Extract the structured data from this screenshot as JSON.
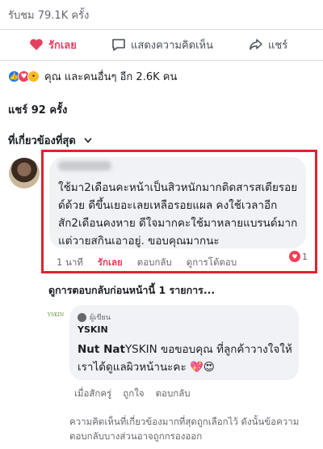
{
  "post": {
    "views": "รับชม 79.1K ครั้ง",
    "actions": {
      "like_label": "รักเลย",
      "comment_label": "แสดงความคิดเห็น",
      "share_label": "แชร์"
    },
    "reactions_text": "คุณ และคนอื่นๆ อีก 2.6K คน",
    "shares_text": "แชร์ 92 ครั้ง",
    "sort_label": "ที่เกี่ยวข้องที่สุด"
  },
  "comment": {
    "text": "ใช้มา2เดือนคะหน้าเป็นสิวหนักมากติดสารสเตียรอยด์ด้วย ดีขึ้นเยอะเลยเหลือรอยแผล คงใช้เวลาอีกสัก2เดือนคงหาย    ดีใจมากคะใช้มาหลายแบรนด์มากแต่วายสกินเอาอยู่. ขอบคุณมากนะ",
    "time": "1 นาที",
    "liked_label": "รักเลย",
    "reply_label": "ตอบกลับ",
    "view_replies_label": "ดูการโต้ตอบ",
    "reaction_count": "1",
    "highlight_color": "#e1222f"
  },
  "previous_replies": "ดูการตอบกลับก่อนหน้านี้ 1 รายการ...",
  "reply": {
    "logo_text": "YSKIN",
    "author_badge": "ผู้เขียน",
    "page_name": "YSKIN",
    "mention": "Nut Nat",
    "text": "YSKIN ขอขอบคุณ ที่ลูกค้าวางใจให้เราได้ดูแลผิวหน้านะคะ 💖😍",
    "time": "เมื่อสักครู่",
    "like_label": "ถูกใจ",
    "reply_label": "ตอบกลับ"
  },
  "footer_note": "ความคิดเห็นที่เกี่ยวข้องมากที่สุดถูกเลือกไว้ ดังนั้นข้อความตอบกลับบางส่วนอาจถูกกรองออก"
}
